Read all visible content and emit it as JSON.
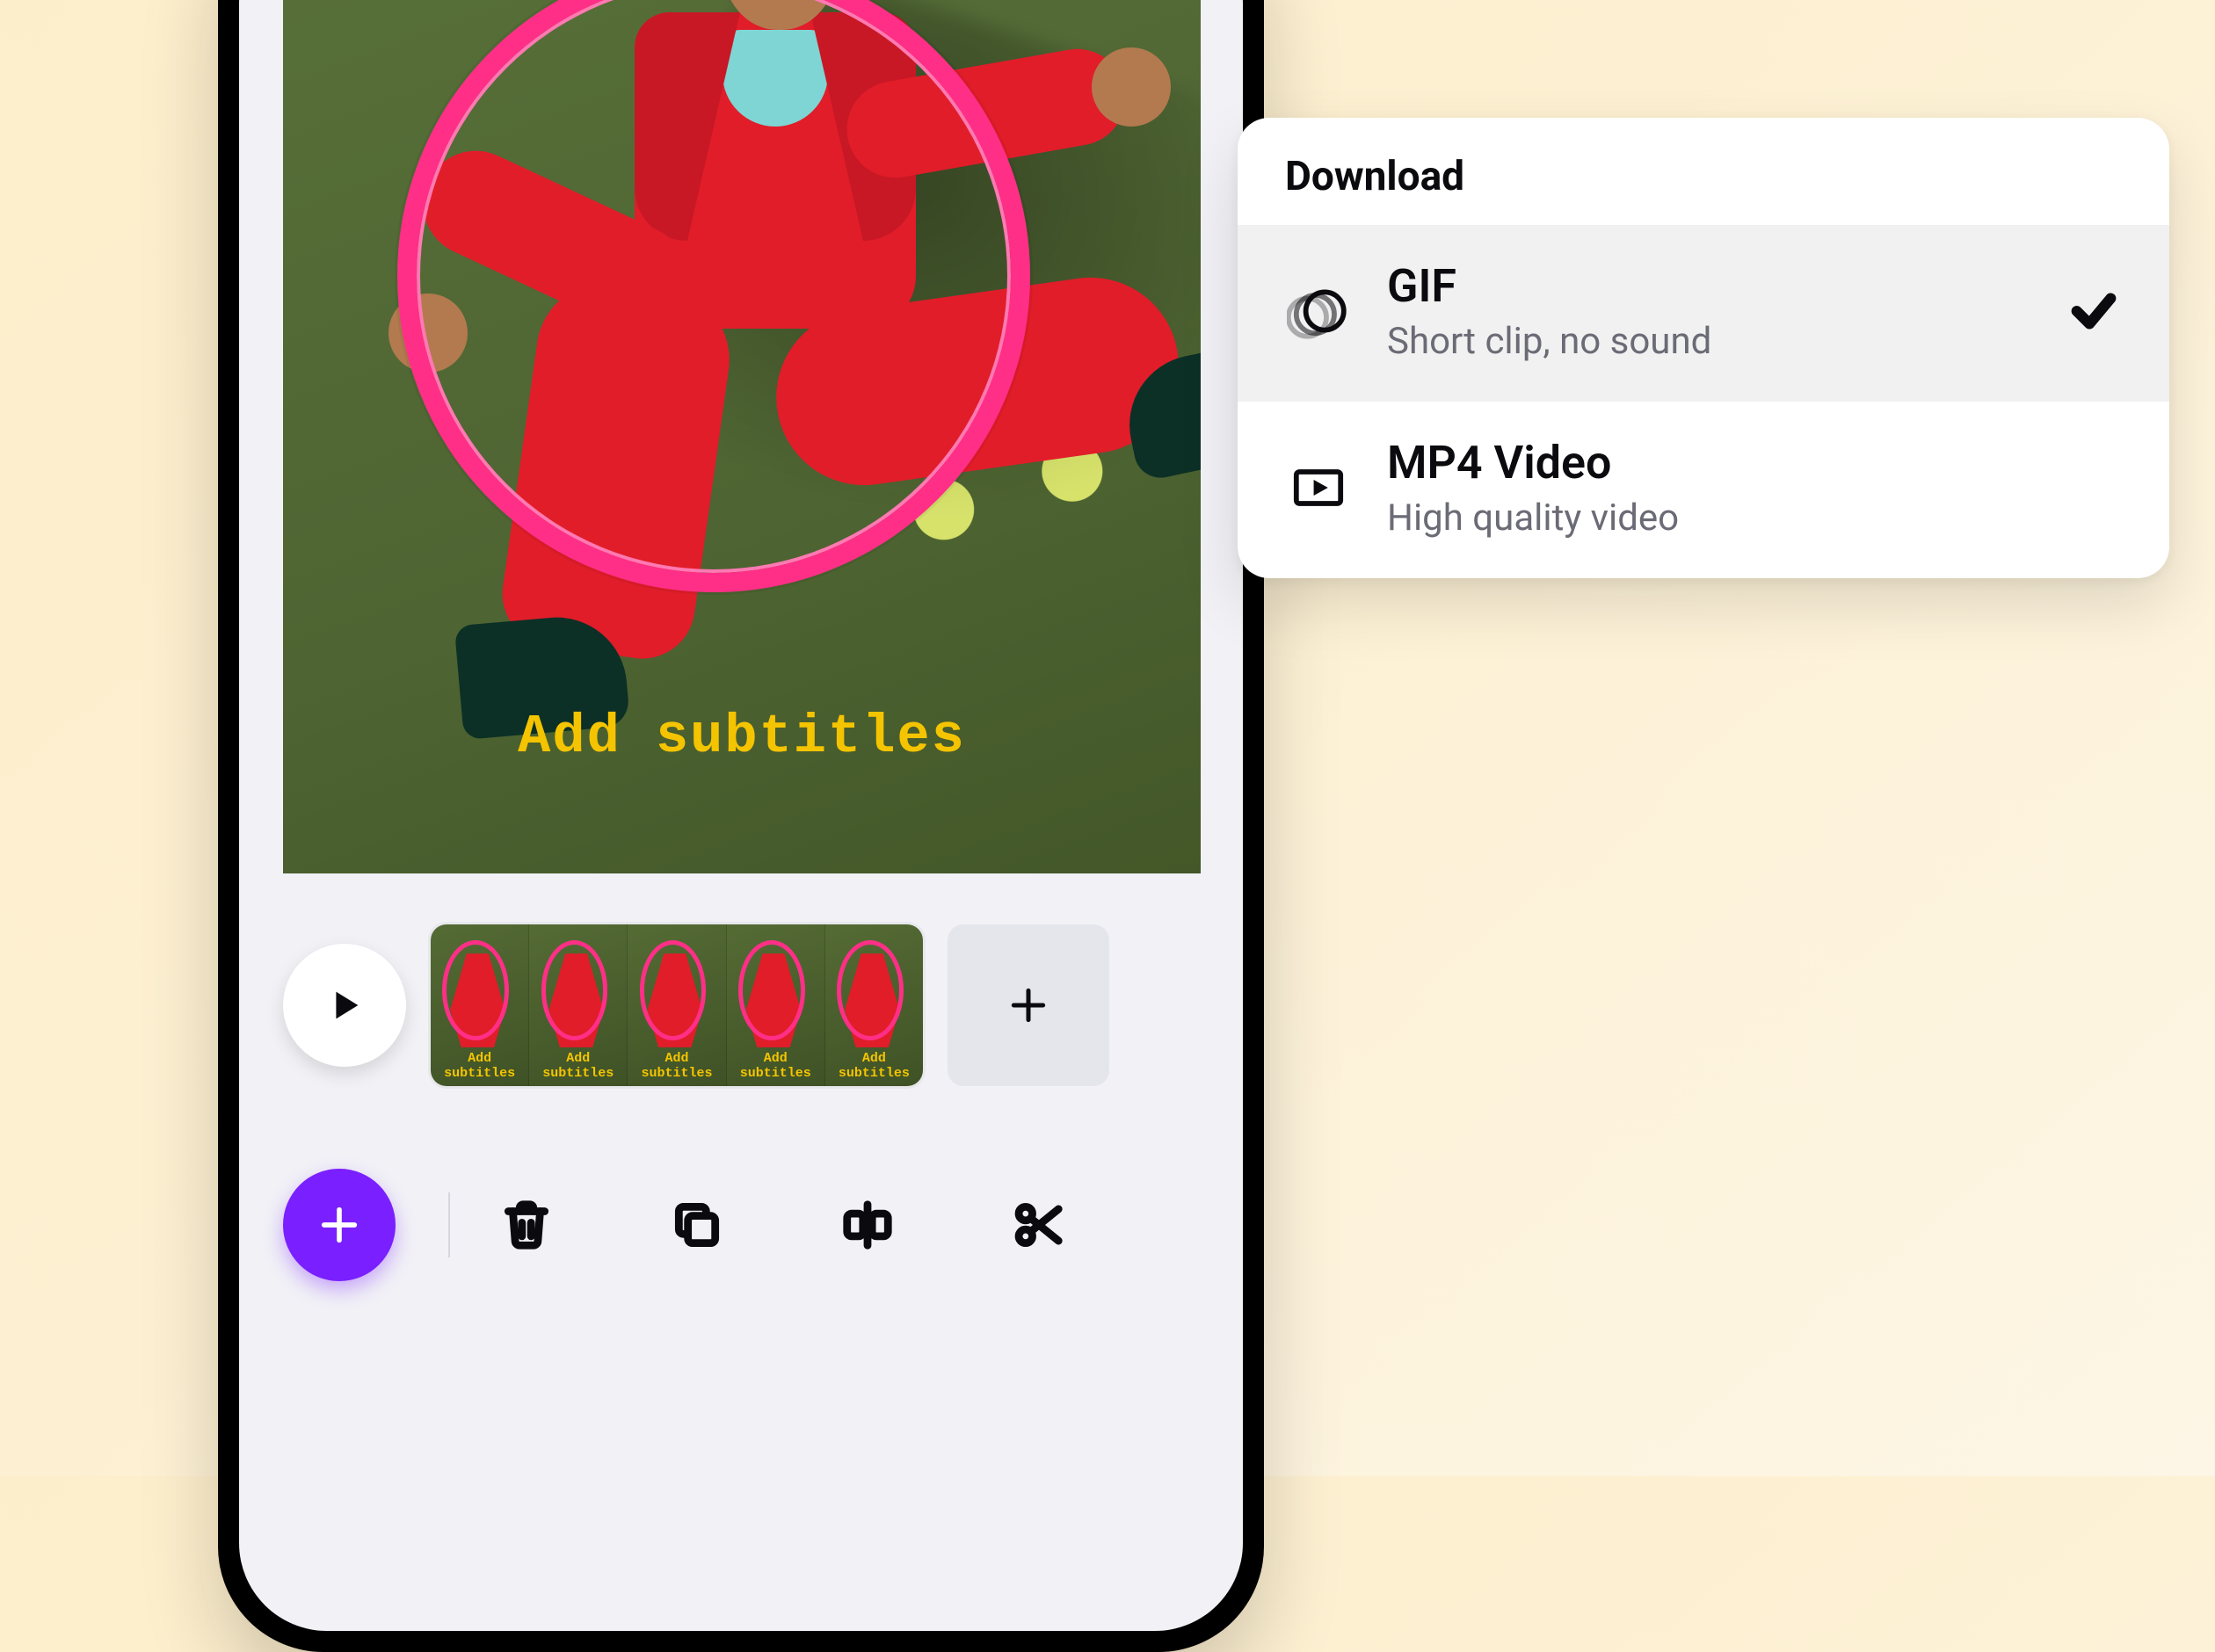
{
  "preview": {
    "subtitle_overlay": "Add subtitles"
  },
  "timeline": {
    "thumb_caption": "Add subtitles",
    "thumb_count": 5
  },
  "download_panel": {
    "title": "Download",
    "options": [
      {
        "title": "GIF",
        "subtitle": "Short clip, no sound",
        "selected": true,
        "icon": "gif"
      },
      {
        "title": "MP4 Video",
        "subtitle": "High quality video",
        "selected": false,
        "icon": "video"
      }
    ]
  },
  "colors": {
    "accent_purple": "#7a1fff",
    "hoop_pink": "#ff2f87",
    "subtitle_yellow": "#f5c400"
  }
}
